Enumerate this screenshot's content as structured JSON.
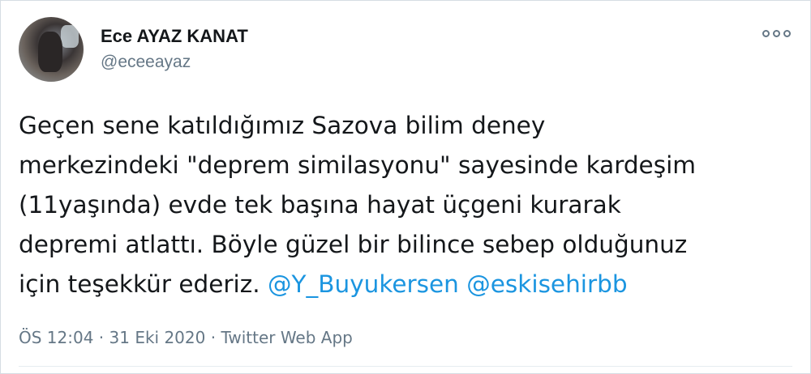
{
  "author": {
    "display_name": "Ece AYAZ KANAT",
    "handle": "@eceeayaz"
  },
  "tweet": {
    "lines": [
      "Geçen sene katıldığımız Sazova bilim deney",
      "merkezindeki \"deprem similasyonu\" sayesinde kardeşim",
      "(11yaşında) evde tek başına hayat üçgeni kurarak",
      "depremi atlattı. Böyle güzel bir bilince sebep olduğunuz"
    ],
    "last_line_prefix": "için teşekkür ederiz. ",
    "mentions": [
      "@Y_Buyukersen",
      "@eskisehirbb"
    ]
  },
  "meta": {
    "time": "ÖS 12:04",
    "separator": " · ",
    "date": "31 Eki 2020",
    "source": "Twitter Web App"
  },
  "icons": {
    "more": "more-options-icon"
  },
  "colors": {
    "text": "#14171a",
    "secondary": "#657786",
    "link": "#1b95e0",
    "border": "#d6dde3"
  }
}
